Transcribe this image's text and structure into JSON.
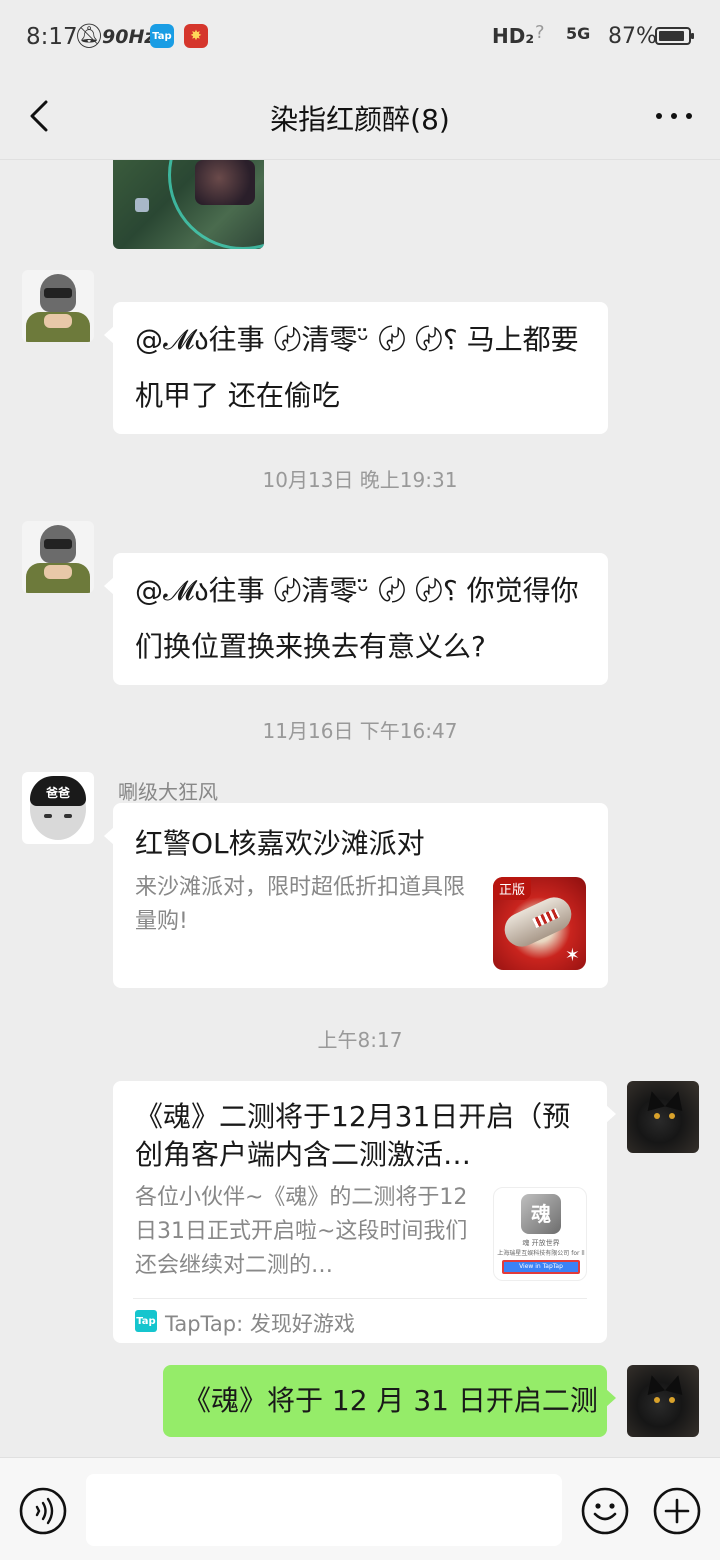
{
  "status_bar": {
    "time": "8:17",
    "refresh_rate": "90Hz",
    "app_icon_1": "Tap",
    "app_icon_2": "✸",
    "hd": "HD₂",
    "wifi": "?",
    "signal": "5G",
    "battery_percent": "87%"
  },
  "nav": {
    "title": "染指红颜醉(8)"
  },
  "messages": {
    "msg1": {
      "text": "@𝓜ა往事 〄清零ᵕ̈ 〄 〄⸮ 马上都要机甲了 还在偷吃"
    },
    "ts1": "10月13日 晚上19:31",
    "msg2": {
      "text": "@𝓜ა往事 〄清零ᵕ̈ 〄 〄⸮ 你觉得你们换位置换来换去有意义么?"
    },
    "ts2": "11月16日 下午16:47",
    "msg3": {
      "sender": "唰级大狂风",
      "avatar_text": "爸爸",
      "card_title": "红警OL核嘉欢沙滩派对",
      "card_desc": "来沙滩派对，限时超低折扣道具限量购!",
      "thumb_tag": "正版"
    },
    "ts3": "上午8:17",
    "msg4": {
      "card_title": "《魂》二测将于12月31日开启（预创角客户端内含二测激活…",
      "card_desc": "各位小伙伴~《魂》的二测将于12日31日正式开启啦~这段时间我们还会继续对二测的…",
      "thumb_logo": "魂",
      "thumb_line1": "魂 开放世界",
      "thumb_line2": "上海瑞星互娱科技有限公司 for ll",
      "thumb_button": "View in TapTap",
      "source_icon": "Tap",
      "source_text": "TapTap: 发现好游戏"
    },
    "msg5": {
      "text": "《魂》将于 12 月 31 日开启二测"
    }
  },
  "input_bar": {
    "placeholder": ""
  },
  "colors": {
    "background": "#ededed",
    "green_bubble": "#95ec69",
    "white_bubble": "#ffffff"
  }
}
